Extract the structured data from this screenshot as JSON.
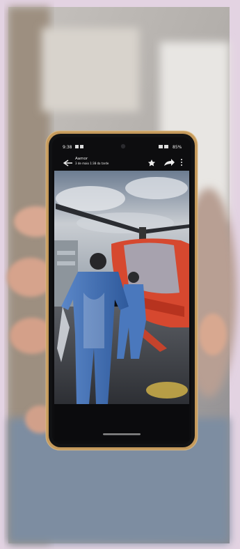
{
  "photo": {
    "frame_color": "#e3d3e2",
    "phone_frame_color": "#c59a5c"
  },
  "phone_status_bar": {
    "time": "9:38",
    "battery": "85%"
  },
  "viewer_header": {
    "contact_name": "Aamor",
    "timestamp": "3 de maio 1:38 da tarde"
  },
  "icons": [
    "back-arrow-icon",
    "star-icon",
    "share-icon",
    "more-vert-icon"
  ],
  "scene": {
    "subject": "workers in blue protective gowns beside a red helicopter",
    "colors": {
      "gown": "#3f6fb6",
      "helicopter": "#d6482f",
      "sky": "#b9c2cc"
    }
  }
}
